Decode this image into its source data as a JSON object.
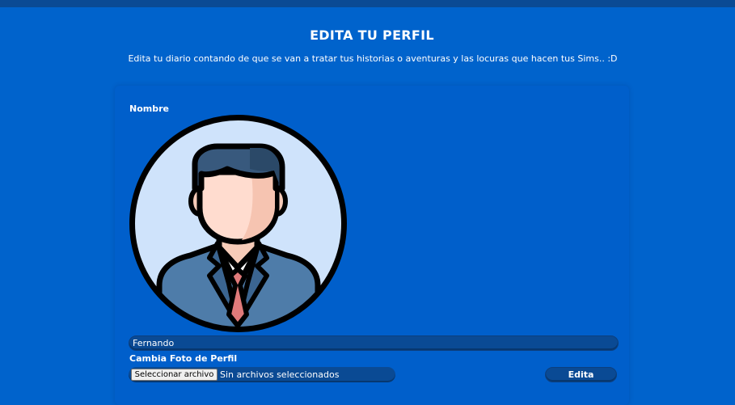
{
  "header": {
    "title": "EDITA TU PERFIL",
    "subtitle": "Edita tu diario contando de que se van a tratar tus historias o aventuras y las locuras que hacen tus Sims.. :D"
  },
  "form": {
    "name_label": "Nombre",
    "avatar_icon": "user-avatar-icon",
    "name_value": "Fernando",
    "photo_label": "Cambia Foto de Perfil",
    "file_button_label": "Seleccionar archivo",
    "file_status": "Sin archivos seleccionados",
    "submit_label": "Edita"
  },
  "colors": {
    "background": "#0063CC",
    "top_bar": "#0A4A94",
    "input": "#0A4A94",
    "text": "#FFFFFF"
  }
}
